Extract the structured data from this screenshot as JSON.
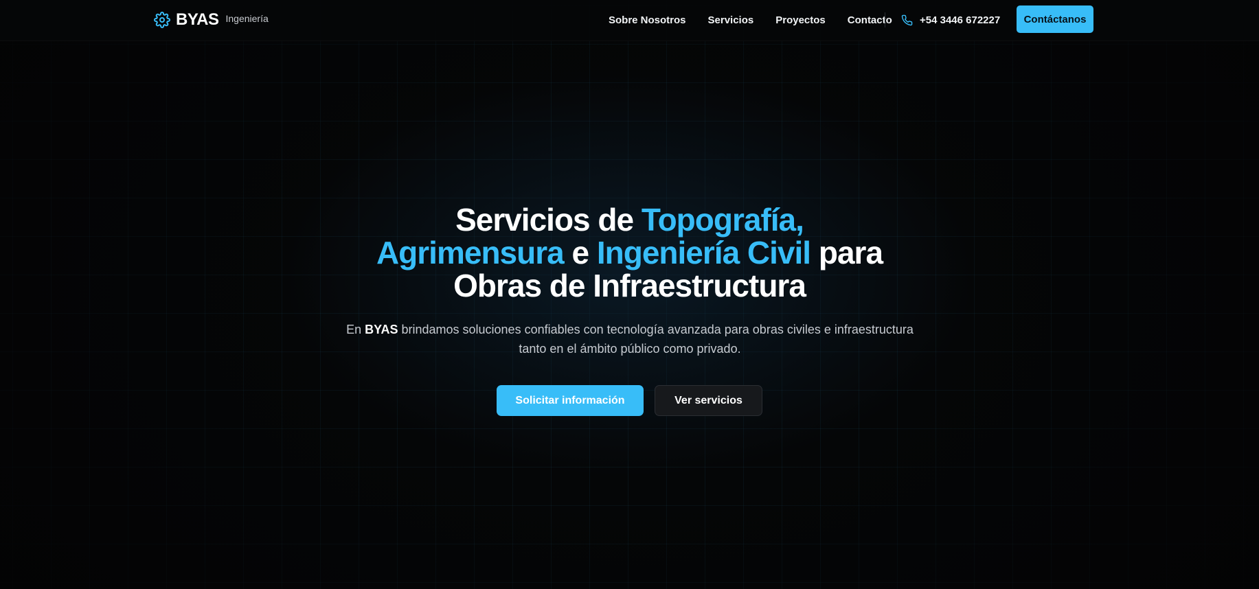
{
  "header": {
    "brand": "BYAS",
    "brand_sub": "Ingeniería",
    "nav": [
      {
        "label": "Sobre Nosotros"
      },
      {
        "label": "Servicios"
      },
      {
        "label": "Proyectos"
      },
      {
        "label": "Contacto"
      }
    ],
    "phone": "+54 3446 672227",
    "cta_label": "Contáctanos",
    "icons": {
      "logo": "gear-icon",
      "phone": "phone-icon"
    }
  },
  "hero": {
    "title": {
      "l1_a": "Servicios de ",
      "l1_b": "Topografía,",
      "l2_a": "Agrimensura",
      "l2_b": " e ",
      "l2_c": "Ingeniería Civil",
      "l2_d": " para",
      "l3": "Obras de Infraestructura"
    },
    "desc": {
      "pre": "En ",
      "brand": "BYAS",
      "post": " brindamos soluciones confiables con tecnología avanzada para obras civiles e infraestructura tanto en el ámbito público como privado."
    },
    "primary_label": "Solicitar información",
    "secondary_label": "Ver servicios"
  },
  "colors": {
    "accent": "#38bdf8",
    "background": "#050607",
    "secondary_button": "#17191c"
  }
}
